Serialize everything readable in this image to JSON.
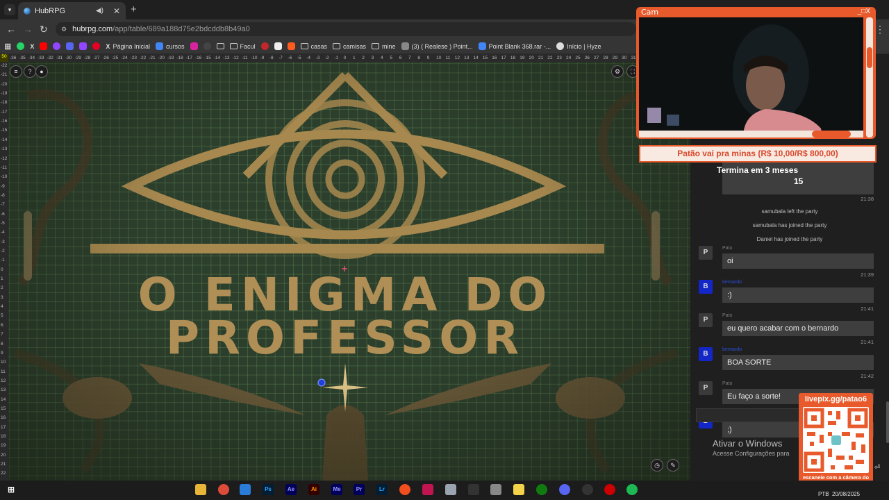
{
  "browser": {
    "tab_title": "HubRPG",
    "url_domain": "hubrpg.com",
    "url_path": "/app/table/689a188d75e2bdcddb8b49a0",
    "bookmarks": [
      "Página Inicial",
      "cursos",
      "Facul",
      "casas",
      "camisas",
      "mine",
      "(3) ( Realese ) Point...",
      "Point Blank 368.rar -...",
      "Início | Hyze"
    ]
  },
  "map": {
    "title_line1": "O ENIGMA DO",
    "title_line2": "PROFESSOR",
    "ruler_top": [
      "-36",
      "-35",
      "-34",
      "-33",
      "-32",
      "-31",
      "-30",
      "-29",
      "-28",
      "-27",
      "-26",
      "-25",
      "-24",
      "-23",
      "-22",
      "-21",
      "-20",
      "-19",
      "-18",
      "-17",
      "-16",
      "-15",
      "-14",
      "-13",
      "-12",
      "-11",
      "-10",
      "-9",
      "-8",
      "-7",
      "-6",
      "-5",
      "-4",
      "-3",
      "-2",
      "-1",
      "0",
      "1",
      "2",
      "3",
      "4",
      "5",
      "6",
      "7",
      "8",
      "9",
      "10",
      "11",
      "12",
      "13",
      "14",
      "15",
      "16",
      "17",
      "18",
      "19",
      "20",
      "21",
      "22",
      "23",
      "24",
      "25",
      "26",
      "27",
      "28",
      "29",
      "30",
      "31"
    ],
    "ruler_left": [
      "-22",
      "-21",
      "-20",
      "-19",
      "-18",
      "-17",
      "-16",
      "-15",
      "-14",
      "-13",
      "-12",
      "-11",
      "-10",
      "-9",
      "-8",
      "-7",
      "-6",
      "-5",
      "-4",
      "-3",
      "-2",
      "-1",
      "0",
      "1",
      "2",
      "3",
      "4",
      "5",
      "6",
      "7",
      "8",
      "9",
      "10",
      "11",
      "12",
      "13",
      "14",
      "15",
      "16",
      "17",
      "18",
      "19",
      "20",
      "21",
      "22"
    ],
    "ruler_corner": "50"
  },
  "cam": {
    "title": "Cam",
    "controls": "_□X"
  },
  "goal": {
    "text": "Patão vai pra minas (R$ 10,00/R$ 800,00)",
    "subtitle": "Termina em 3 meses",
    "number": "15"
  },
  "chat": {
    "first_time": "21:38",
    "system": [
      "samubala left the party",
      "samubala has joined the party",
      "Daniel has joined the party"
    ],
    "messages": [
      {
        "avatar": "P",
        "user": "Pato",
        "text": "oi",
        "time": "21:39"
      },
      {
        "avatar": "B",
        "user": "bernardo",
        "text": ":)",
        "time": "21:41"
      },
      {
        "avatar": "P",
        "user": "Pato",
        "text": "eu quero acabar com o bernardo",
        "time": "21:41"
      },
      {
        "avatar": "B",
        "user": "bernardo",
        "text": "BOA SORTE",
        "time": "21:42"
      },
      {
        "avatar": "P",
        "user": "Pato",
        "text": "Eu faço a sorte!",
        "time": ""
      },
      {
        "avatar": "B",
        "user": "bernardo",
        "text": ";)",
        "time": ""
      }
    ]
  },
  "qr": {
    "title": "livepix.gg/patao6",
    "footer": "escaneie com a câmera do celular! #005F94"
  },
  "windows": {
    "activate_title": "Ativar o Windows",
    "activate_sub": "Acesse Configurações para",
    "lang": "PTB",
    "date": "20/08/2025"
  },
  "colors": {
    "accent_orange": "#e85a2c",
    "map_green": "#2c3f2c",
    "gold": "#b08f56",
    "blue_avatar": "#1326c8"
  }
}
